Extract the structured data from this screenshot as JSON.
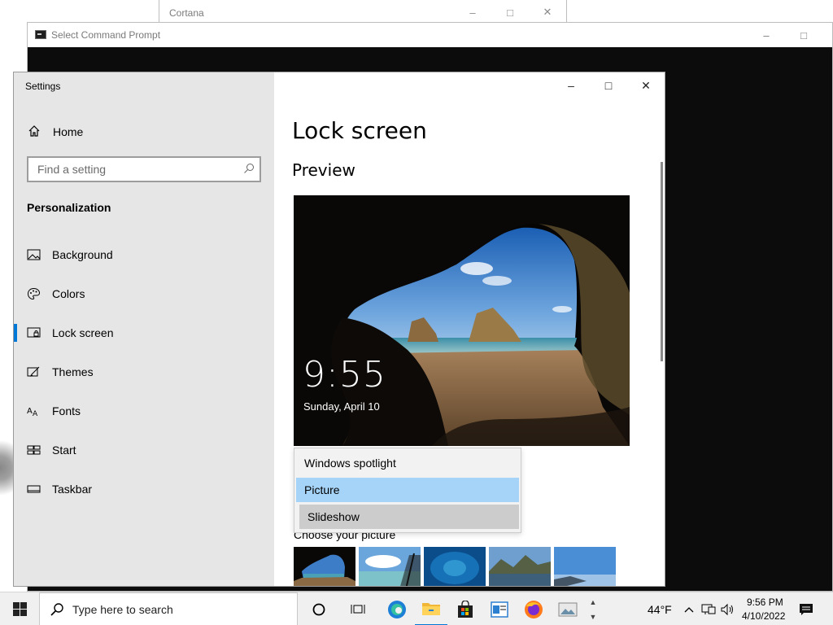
{
  "cortana": {
    "title": "Cortana"
  },
  "cmd": {
    "title": "Select Command Prompt"
  },
  "settings": {
    "window_title": "Settings",
    "home_label": "Home",
    "search_placeholder": "Find a setting",
    "section": "Personalization",
    "nav": [
      {
        "label": "Background",
        "icon": "picture-icon"
      },
      {
        "label": "Colors",
        "icon": "palette-icon"
      },
      {
        "label": "Lock screen",
        "icon": "lock-screen-icon",
        "active": true
      },
      {
        "label": "Themes",
        "icon": "themes-icon"
      },
      {
        "label": "Fonts",
        "icon": "fonts-icon"
      },
      {
        "label": "Start",
        "icon": "start-icon"
      },
      {
        "label": "Taskbar",
        "icon": "taskbar-icon"
      }
    ],
    "page_title": "Lock screen",
    "preview_heading": "Preview",
    "preview_time": "9:55",
    "preview_date": "Sunday, April 10",
    "dropdown_options": [
      "Windows spotlight",
      "Picture",
      "Slideshow"
    ],
    "dropdown_selected": "Picture",
    "choose_label": "Choose your picture"
  },
  "taskbar": {
    "search_placeholder": "Type here to search",
    "weather": "44°F",
    "time": "9:56 PM",
    "date": "4/10/2022"
  },
  "colors": {
    "accent": "#0078d7",
    "selection": "#a6d3f8"
  }
}
